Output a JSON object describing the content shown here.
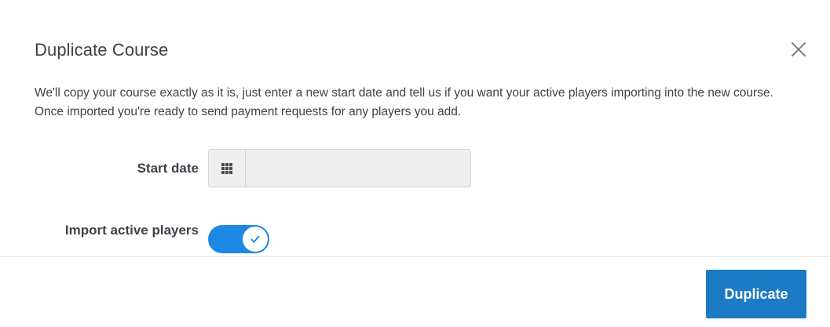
{
  "modal": {
    "title": "Duplicate Course",
    "description": "We'll copy your course exactly as it is, just enter a new start date and tell us if you want your active players importing into the new course. Once imported you're ready to send payment requests for any players you add.",
    "close_icon": "close-icon"
  },
  "form": {
    "start_date": {
      "label": "Start date",
      "value": "",
      "placeholder": "",
      "icon": "calendar-grid-icon"
    },
    "import_active_players": {
      "label": "Import active players",
      "checked": true,
      "icon": "check-icon"
    }
  },
  "footer": {
    "primary_label": "Duplicate"
  },
  "colors": {
    "accent": "#1e88e5",
    "button": "#1b7bc4",
    "text": "#3f4148",
    "input_bg": "#efefef"
  }
}
